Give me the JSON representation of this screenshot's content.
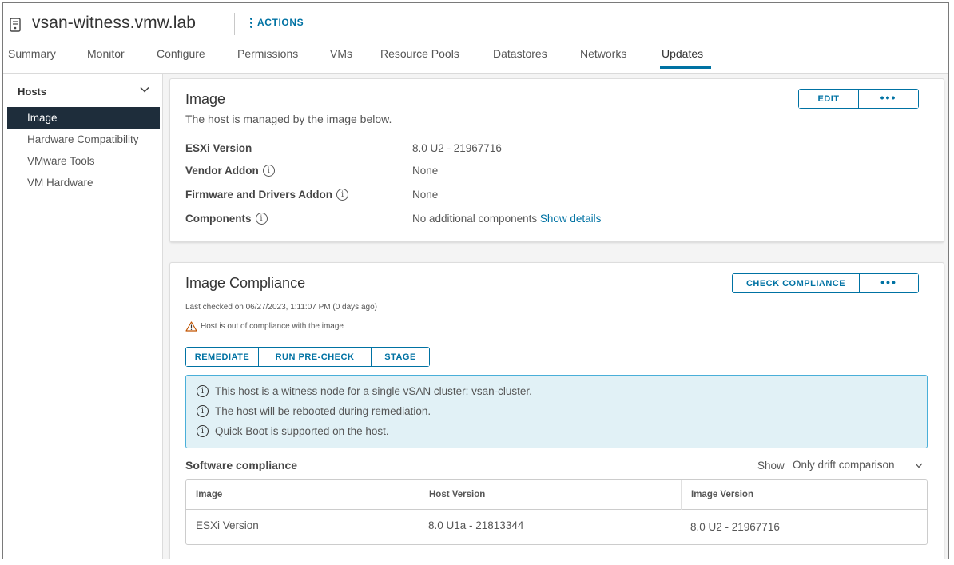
{
  "header": {
    "title": "vsan-witness.vmw.lab",
    "actions_label": "ACTIONS"
  },
  "tabs": [
    {
      "label": "Summary"
    },
    {
      "label": "Monitor"
    },
    {
      "label": "Configure"
    },
    {
      "label": "Permissions"
    },
    {
      "label": "VMs"
    },
    {
      "label": "Resource Pools"
    },
    {
      "label": "Datastores"
    },
    {
      "label": "Networks"
    },
    {
      "label": "Updates"
    }
  ],
  "sidebar": {
    "section": "Hosts",
    "items": [
      {
        "label": "Image"
      },
      {
        "label": "Hardware Compatibility"
      },
      {
        "label": "VMware Tools"
      },
      {
        "label": "VM Hardware"
      }
    ]
  },
  "image_card": {
    "title": "Image",
    "subtitle": "The host is managed by the image below.",
    "edit_label": "EDIT",
    "more_label": "•••",
    "rows": [
      {
        "label": "ESXi Version",
        "value": "8.0 U2 - 21967716"
      },
      {
        "label": "Vendor Addon",
        "value": "None"
      },
      {
        "label": "Firmware and Drivers Addon",
        "value": "None"
      },
      {
        "label": "Components",
        "value": "No additional components",
        "link": "Show details"
      }
    ]
  },
  "compliance_card": {
    "title": "Image Compliance",
    "check_label": "CHECK COMPLIANCE",
    "more_label": "•••",
    "last_checked": "Last checked on 06/27/2023, 1:11:07 PM (0 days ago)",
    "warning": "Host is out of compliance with the image",
    "actions": {
      "remediate": "REMEDIATE",
      "precheck": "RUN PRE-CHECK",
      "stage": "STAGE"
    },
    "alerts": [
      "This host is a witness node for a single vSAN cluster: vsan-cluster.",
      "The host will be rebooted during remediation.",
      "Quick Boot is supported on the host."
    ],
    "software_title": "Software compliance",
    "show_label": "Show",
    "show_value": "Only drift comparison",
    "table": {
      "headers": [
        "Image",
        "Host Version",
        "Image Version"
      ],
      "rows": [
        [
          "ESXi Version",
          "8.0 U1a - 21813344",
          "8.0 U2 - 21967716"
        ]
      ]
    }
  },
  "colors": {
    "accent": "#0072a3",
    "sidebar_active": "#1e2d3b",
    "alert_bg": "#e1f1f6",
    "alert_border": "#49afd9",
    "warning": "#c25400"
  }
}
